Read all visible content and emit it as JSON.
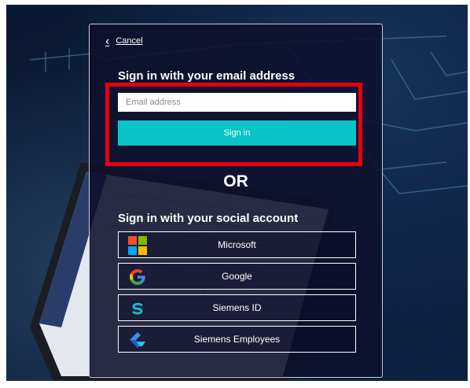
{
  "login": {
    "cancel_label": "Cancel",
    "email_heading": "Sign in with your email address",
    "email_placeholder": "Email address",
    "signin_label": "Sign in",
    "or_label": "OR",
    "social_heading": "Sign in with your social account",
    "providers": [
      {
        "label": "Microsoft",
        "icon": "microsoft-logo-icon"
      },
      {
        "label": "Google",
        "icon": "google-logo-icon"
      },
      {
        "label": "Siemens ID",
        "icon": "siemens-id-logo-icon"
      },
      {
        "label": "Siemens Employees",
        "icon": "siemens-employees-logo-icon"
      }
    ]
  },
  "colors": {
    "accent": "#08c4c6",
    "highlight": "#e8000f",
    "panel": "#0e102c"
  }
}
